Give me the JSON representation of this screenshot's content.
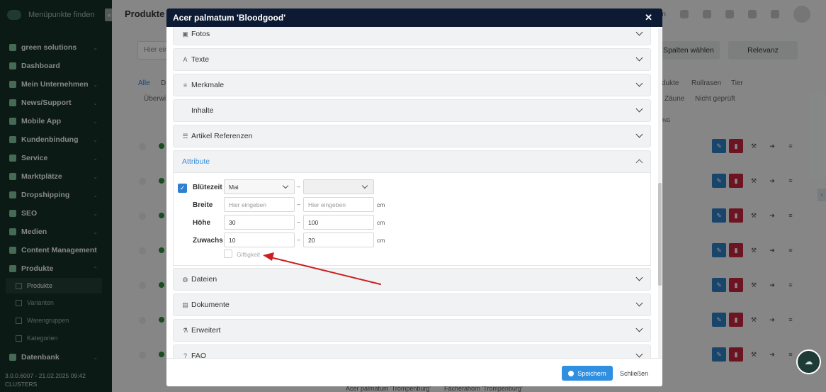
{
  "sidebar": {
    "search_label": "Menüpunkte finden",
    "items": [
      {
        "label": "green solutions"
      },
      {
        "label": "Dashboard"
      },
      {
        "label": "Mein Unternehmen"
      },
      {
        "label": "News/Support"
      },
      {
        "label": "Mobile App"
      },
      {
        "label": "Kundenbindung"
      },
      {
        "label": "Service"
      },
      {
        "label": "Marktplätze"
      },
      {
        "label": "Dropshipping"
      },
      {
        "label": "SEO"
      },
      {
        "label": "Medien"
      },
      {
        "label": "Content Management"
      },
      {
        "label": "Produkte"
      },
      {
        "label": "Datenbank"
      }
    ],
    "subitems": [
      {
        "label": "Produkte"
      },
      {
        "label": "Varianten"
      },
      {
        "label": "Warengruppen"
      },
      {
        "label": "Kategorien"
      }
    ],
    "footer_version": "3.0.0.6007 - 21.02.2025 09:42",
    "footer_name": "CLUSTERS"
  },
  "background": {
    "page_title": "Produkte",
    "search_placeholder": "Hier ein",
    "top_partial": "leeren",
    "spalten_label": "Spalten wählen",
    "relevanz_label": "Relevanz",
    "tabs_row1": [
      "Alle",
      "D",
      "dukte",
      "Rollrasen",
      "Tier"
    ],
    "tabs_row2": [
      "Überwi",
      "Zäune",
      "Nicht geprüft"
    ],
    "col_header_partial": "UNG",
    "bottom_text_1": "Acer palmatum 'Trompenburg'",
    "bottom_text_2": "Fächerahorn 'Trompenburg'"
  },
  "modal": {
    "title": "Acer palmatum 'Bloodgood'",
    "close_icon": "✕",
    "sections": [
      {
        "label": "Fotos",
        "icon": "image-icon"
      },
      {
        "label": "Texte",
        "icon": "text-icon"
      },
      {
        "label": "Merkmale",
        "icon": "list-icon"
      },
      {
        "label": "Inhalte",
        "icon": ""
      },
      {
        "label": "Artikel Referenzen",
        "icon": "list-ordered-icon"
      },
      {
        "label": "Attribute",
        "icon": ""
      },
      {
        "label": "Dateien",
        "icon": "globe-icon"
      },
      {
        "label": "Dokumente",
        "icon": "document-icon"
      },
      {
        "label": "Erweitert",
        "icon": "flask-icon"
      },
      {
        "label": "FAQ",
        "icon": "question-icon"
      }
    ],
    "attributes": {
      "bluetezeit": {
        "label": "Blütezeit",
        "from": "Mai",
        "to": "",
        "checked": true
      },
      "breite": {
        "label": "Breite",
        "from_placeholder": "Hier eingeben",
        "to_placeholder": "Hier eingeben",
        "unit": "cm"
      },
      "hoehe": {
        "label": "Höhe",
        "from": "30",
        "to": "100",
        "unit": "cm"
      },
      "zuwachs": {
        "label": "Zuwachs",
        "from": "10",
        "to": "20",
        "unit": "cm"
      },
      "giftigkeit": {
        "label": "Giftigkeit",
        "checked": false
      },
      "range_separator": "–"
    },
    "footer": {
      "save_label": "Speichern",
      "close_label": "Schließen"
    }
  },
  "colors": {
    "modal_header": "#0c1b33",
    "sidebar": "#173128",
    "accent_blue": "#2f8fe0",
    "annotation_arrow": "#cc1f1f"
  }
}
